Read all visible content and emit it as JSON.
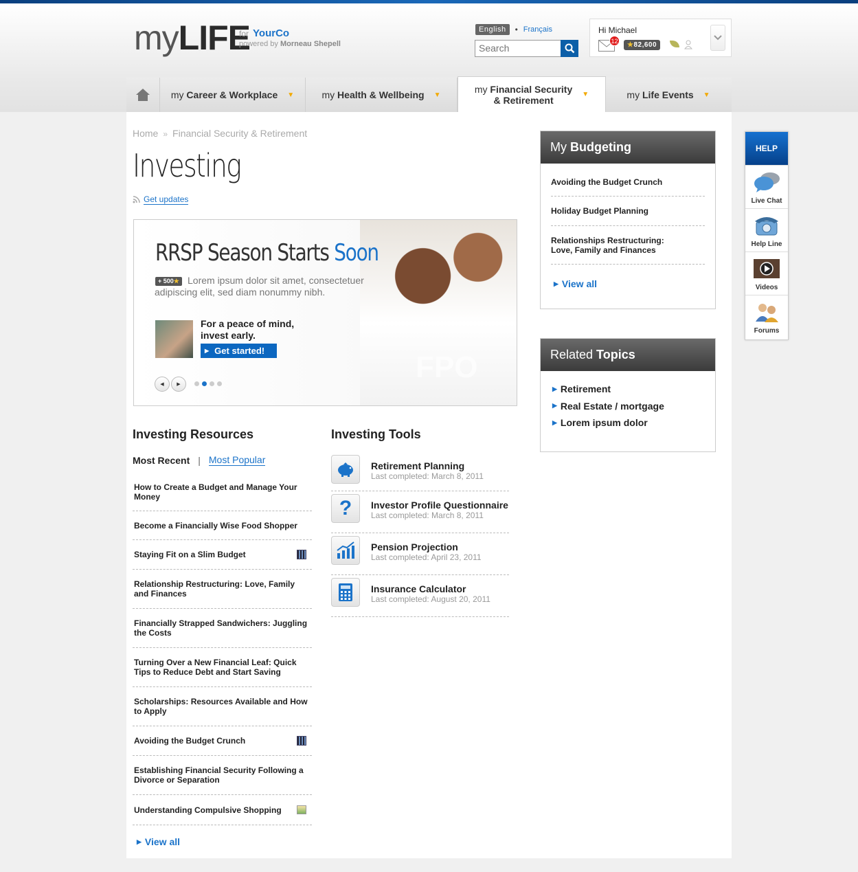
{
  "brand": {
    "my": "my",
    "life": "LIFE",
    "for": "for",
    "company": "YourCo",
    "powered_prefix": "powered by",
    "powered_by": "Morneau Shepell"
  },
  "lang": {
    "active": "English",
    "sep": "•",
    "other": "Français"
  },
  "search": {
    "placeholder": "Search"
  },
  "user": {
    "greeting": "Hi Michael",
    "messages": "12",
    "points": "82,600"
  },
  "nav": [
    {
      "my": "my",
      "label": "Career & Workplace"
    },
    {
      "my": "my",
      "label": "Health & Wellbeing"
    },
    {
      "my": "my",
      "label": "Financial Security",
      "label2": "& Retirement"
    },
    {
      "my": "my",
      "label": "Life Events"
    }
  ],
  "breadcrumb": {
    "home": "Home",
    "sep": "»",
    "current": "Financial Security & Retirement"
  },
  "page_title": "Investing",
  "get_updates": "Get updates",
  "hero": {
    "title": "RRSP Season Starts",
    "title_accent": "Soon",
    "points": "+ 500",
    "desc": "Lorem ipsum dolor sit amet, consectetuer adipiscing elit, sed diam nonummy nibh.",
    "peace_line1": "For a peace of mind,",
    "peace_line2": "invest early.",
    "cta": "Get started!",
    "fpo": "FPO"
  },
  "resources": {
    "title": "Investing Resources",
    "tab_recent": "Most Recent",
    "tab_sep": "|",
    "tab_popular": "Most Popular",
    "items": [
      {
        "text": "How to Create a Budget and Manage Your Money",
        "icon": ""
      },
      {
        "text": "Become a Financially Wise Food Shopper",
        "icon": ""
      },
      {
        "text": "Staying Fit on a Slim Budget",
        "icon": "video"
      },
      {
        "text": "Relationship Restructuring: Love, Family and Finances",
        "icon": ""
      },
      {
        "text": "Financially Strapped Sandwichers: Juggling the Costs",
        "icon": ""
      },
      {
        "text": "Turning Over a New Financial Leaf: Quick Tips to Reduce Debt and Start Saving",
        "icon": ""
      },
      {
        "text": "Scholarships: Resources Available and How to Apply",
        "icon": ""
      },
      {
        "text": "Avoiding the Budget Crunch",
        "icon": "video"
      },
      {
        "text": "Establishing Financial Security Following a Divorce or Separation",
        "icon": ""
      },
      {
        "text": "Understanding Compulsive Shopping",
        "icon": "image"
      }
    ],
    "view_all": "View all"
  },
  "tools": {
    "title": "Investing Tools",
    "items": [
      {
        "name": "Retirement Planning",
        "date": "Last completed: March 8, 2011",
        "icon": "piggy-bank-icon"
      },
      {
        "name": "Investor Profile Questionnaire",
        "date": "Last completed: March 8, 2011",
        "icon": "question-icon"
      },
      {
        "name": "Pension Projection",
        "date": "Last completed: April 23, 2011",
        "icon": "chart-icon"
      },
      {
        "name": "Insurance Calculator",
        "date": "Last completed: August 20, 2011",
        "icon": "calculator-icon"
      }
    ]
  },
  "budgeting": {
    "title_light": "My",
    "title_bold": "Budgeting",
    "items": [
      "Avoiding the Budget Crunch",
      "Holiday Budget Planning",
      "Relationships Restructuring: Love, Family and Finances"
    ],
    "view_all": "View all"
  },
  "related": {
    "title_light": "Related",
    "title_bold": "Topics",
    "items": [
      "Retirement",
      "Real Estate / mortgage",
      "Lorem ipsum dolor"
    ]
  },
  "help": {
    "title": "HELP",
    "items": [
      "Live Chat",
      "Help Line",
      "Videos",
      "Forums"
    ]
  },
  "colors": {
    "accent": "#1b73c9",
    "nav_arrow": "#f2a900",
    "badge": "#e01c1c"
  }
}
